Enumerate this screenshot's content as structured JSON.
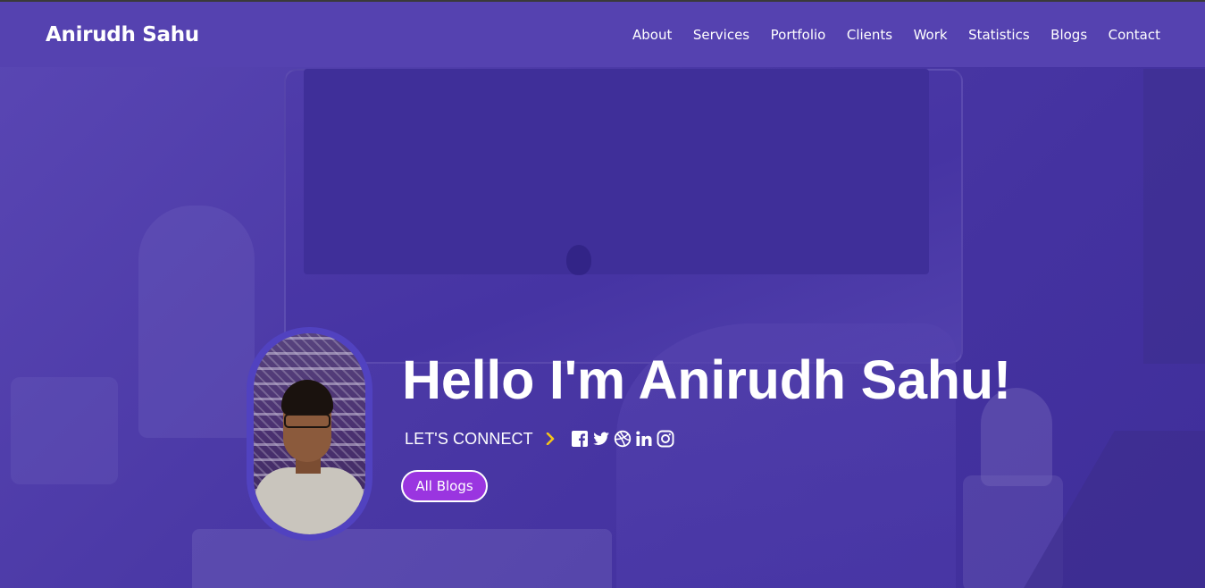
{
  "header": {
    "brand": "Anirudh Sahu",
    "nav": [
      "About",
      "Services",
      "Portfolio",
      "Clients",
      "Work",
      "Statistics",
      "Blogs",
      "Contact"
    ]
  },
  "hero": {
    "title": "Hello I'm Anirudh Sahu!",
    "connect_label": "LET'S CONNECT",
    "socials": [
      "facebook-icon",
      "twitter-icon",
      "dribbble-icon",
      "linkedin-icon",
      "instagram-icon"
    ],
    "button_label": "All Blogs"
  },
  "colors": {
    "header_bg": "#5542b0",
    "accent_chevron": "#f5c518",
    "button_bg": "#9a35e0",
    "avatar_ring": "#5142c0"
  }
}
